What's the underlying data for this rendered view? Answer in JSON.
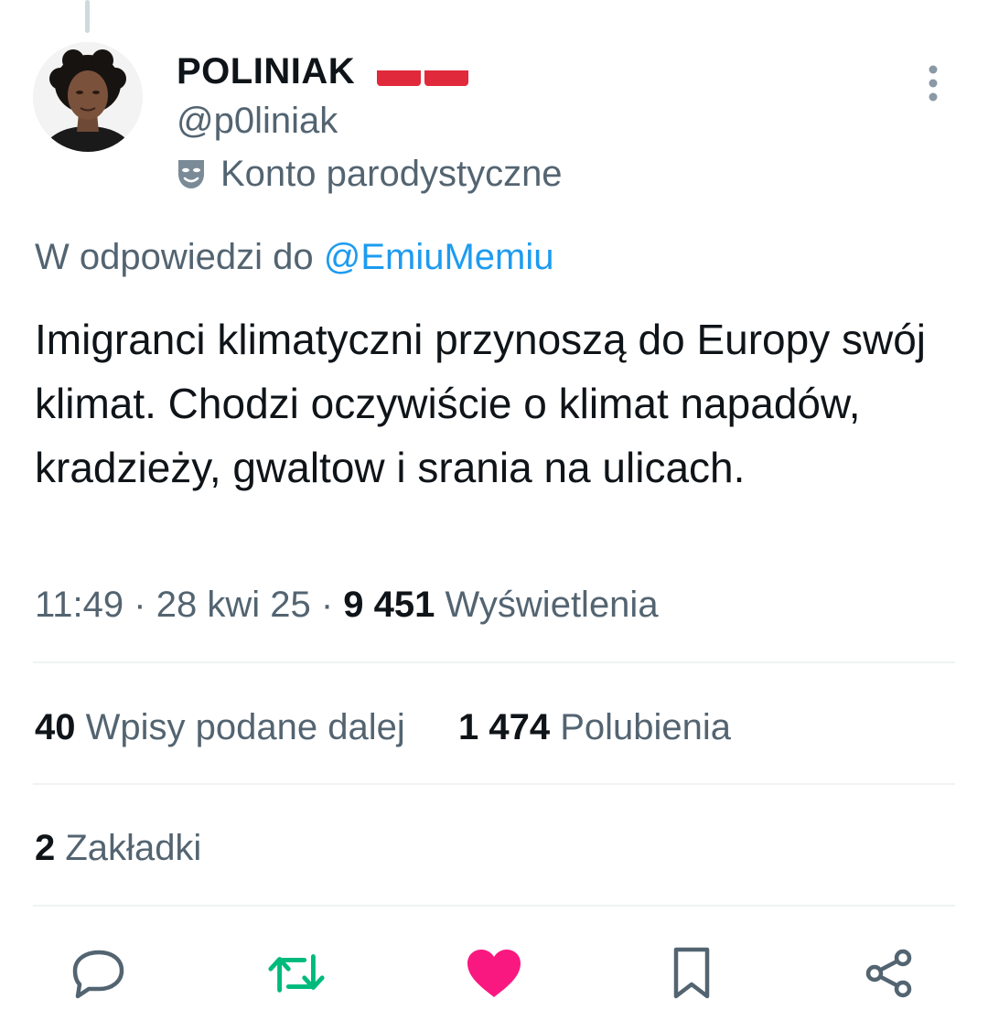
{
  "tweet": {
    "display_name": "POLINIAK",
    "handle": "@p0liniak",
    "parody_label": "Konto parodystyczne",
    "reply_prefix": "W odpowiedzi do",
    "reply_mention": "@EmiuMemiu",
    "text": "Imigranci klimatyczni przynoszą do Europy swój klimat. Chodzi oczywiście o klimat napadów, kradzieży, gwaltow i srania na ulicach.",
    "time": "11:49",
    "date": "28 kwi 25",
    "separator": "·",
    "views_count": "9 451",
    "views_label": "Wyświetlenia"
  },
  "stats": {
    "retweets_count": "40",
    "retweets_label": "Wpisy podane dalej",
    "likes_count": "1 474",
    "likes_label": "Polubienia",
    "bookmarks_count": "2",
    "bookmarks_label": "Zakładki"
  },
  "icons": {
    "flag": "poland-flag-icon",
    "parody": "theater-mask-icon",
    "more": "more-vertical-icon",
    "reply": "reply-icon",
    "retweet": "retweet-icon",
    "like": "heart-icon",
    "bookmark": "bookmark-icon",
    "share": "share-icon"
  },
  "colors": {
    "text_primary": "#0f1419",
    "text_secondary": "#536471",
    "link": "#1d9bf0",
    "retweet_active": "#00ba7c",
    "like_active": "#f91880",
    "divider": "#eff3f4"
  }
}
